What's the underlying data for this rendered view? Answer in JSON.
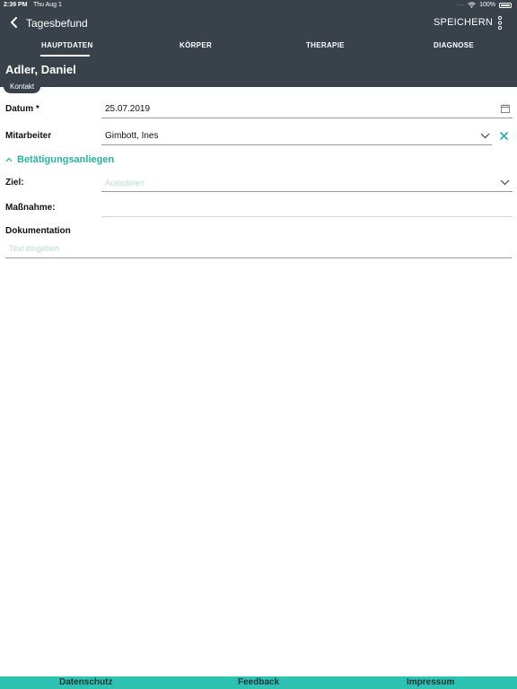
{
  "status_bar": {
    "time": "2:39 PM",
    "date": "Thu Aug 1",
    "battery": "100%",
    "signal_icon": "wifi-icon"
  },
  "header": {
    "back_icon": "chevron-left-icon",
    "title": "Tagesbefund",
    "save_label": "SPEICHERN",
    "more_icon": "more-vertical-icon",
    "background_color": "#39414a"
  },
  "tabs": [
    {
      "label": "HAUPTDATEN",
      "active": true
    },
    {
      "label": "KÖRPER",
      "active": false
    },
    {
      "label": "THERAPIE",
      "active": false
    },
    {
      "label": "DIAGNOSE",
      "active": false
    }
  ],
  "patient": {
    "name": "Adler, Daniel",
    "chip": "Kontakt"
  },
  "form": {
    "datum": {
      "label": "Datum *",
      "value": "25.07.2019",
      "icon": "calendar-icon"
    },
    "mitarbeiter": {
      "label": "Mitarbeiter",
      "value": "Gimbott, Ines",
      "icon": "chevron-down-icon",
      "clear_icon": "close-icon"
    },
    "section": {
      "title": "Betätigungsanliegen",
      "icon": "chevron-up-icon",
      "accent_color": "#26b3a6"
    },
    "ziel": {
      "label": "Ziel:",
      "placeholder": "Auswählen",
      "icon": "chevron-down-icon"
    },
    "massnahme": {
      "label": "Maßnahme:",
      "value": ""
    },
    "dokumentation": {
      "label": "Dokumentation",
      "placeholder": "Text eingeben"
    }
  },
  "footer": {
    "background_color": "#2ec2b3",
    "links": [
      "Datenschutz",
      "Feedback",
      "Impressum"
    ]
  }
}
